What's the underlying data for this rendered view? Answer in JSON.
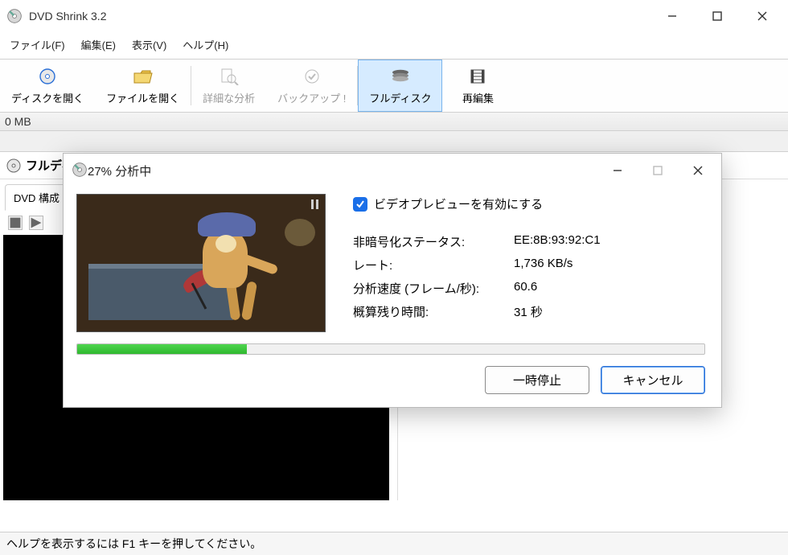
{
  "app": {
    "title": "DVD Shrink 3.2"
  },
  "menu": {
    "file": "ファイル(F)",
    "edit": "編集(E)",
    "view": "表示(V)",
    "help": "ヘルプ(H)"
  },
  "toolbar": {
    "open_disc": "ディスクを開く",
    "open_file": "ファイルを開く",
    "analyze": "詳細な分析",
    "backup": "バックアップ !",
    "full_disc": "フルディスク",
    "reauthor": "再編集"
  },
  "size_strip": "0 MB",
  "content_header": "フルディスク",
  "structure_tab": "DVD 構成",
  "statusbar": "ヘルプを表示するには F1 キーを押してください。",
  "dialog": {
    "title": "27% 分析中",
    "preview_checkbox_label": "ビデオプレビューを有効にする",
    "rows": {
      "decrypt_label": "非暗号化ステータス:",
      "decrypt_value": "EE:8B:93:92:C1",
      "rate_label": "レート:",
      "rate_value": "1,736 KB/s",
      "fps_label": "分析速度 (フレーム/秒):",
      "fps_value": "60.6",
      "eta_label": "概算残り時間:",
      "eta_value": "31 秒"
    },
    "progress_percent": 27,
    "pause": "一時停止",
    "cancel": "キャンセル"
  }
}
